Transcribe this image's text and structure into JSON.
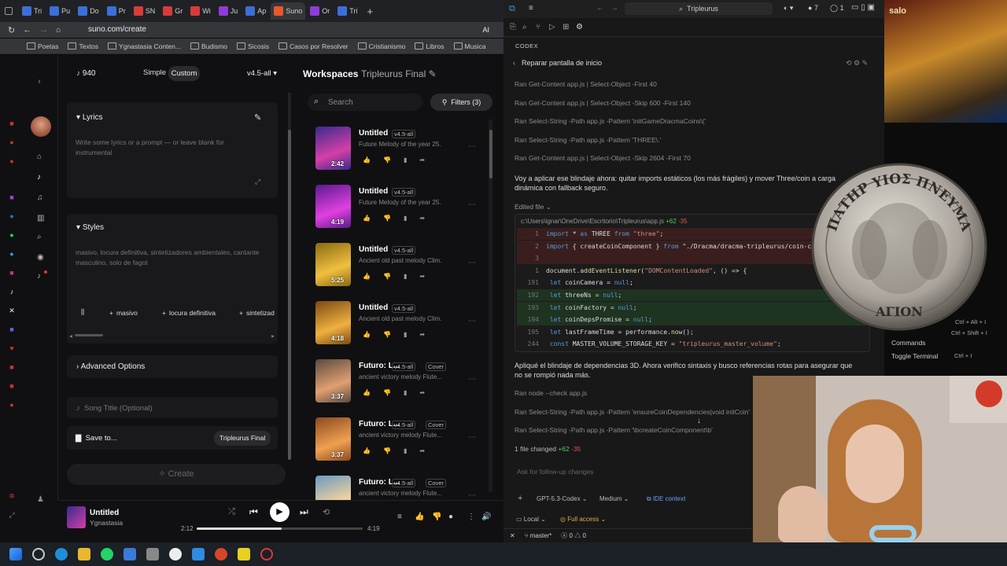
{
  "browser": {
    "tabs": [
      {
        "label": "Tri",
        "color": "#3b6fd8"
      },
      {
        "label": "Pu",
        "color": "#3b6fd8"
      },
      {
        "label": "Do",
        "color": "#3b6fd8"
      },
      {
        "label": "Pr",
        "color": "#3b6fd8"
      },
      {
        "label": "SN",
        "color": "#d83b3b"
      },
      {
        "label": "Gr",
        "color": "#d83b3b"
      },
      {
        "label": "Wi",
        "color": "#d83b3b"
      },
      {
        "label": "Ju",
        "color": "#8e3bd8"
      },
      {
        "label": "Ap",
        "color": "#3b6fd8"
      },
      {
        "label": "Suno",
        "color": "#e8582b",
        "active": true
      },
      {
        "label": "Or",
        "color": "#8e3bd8"
      },
      {
        "label": "Tri",
        "color": "#3b6fd8"
      }
    ],
    "new_tab": "+",
    "url": "suno.com/create",
    "ai_label": "AI",
    "bookmarks": [
      "Poetas",
      "Textos",
      "Ygnastasia Conten...",
      "Budismo",
      "Sicosis",
      "Casos por Resolver",
      "Cristianismo",
      "Libros",
      "Musica"
    ]
  },
  "suno": {
    "credits": "940",
    "mode_simple": "Simple",
    "mode_custom": "Custom",
    "version": "v4.5-all",
    "lyrics": {
      "title": "Lyrics",
      "placeholder": "Write some lyrics or a prompt — or leave blank for instrumental"
    },
    "styles": {
      "title": "Styles",
      "placeholder": "masivo, locura definitiva, sintetizadores ambientales, cantante masculino, solo de fagot"
    },
    "style_chips": [
      "masivo",
      "locura definitiva",
      "sintetizad"
    ],
    "advanced": "Advanced Options",
    "song_title_placeholder": "Song Title (Optional)",
    "save_to": "Save to...",
    "save_target": "Tripleurus Final",
    "create": "Create",
    "workspaces": "Workspaces",
    "workspace_title": "Tripleurus Final",
    "search_placeholder": "Search",
    "filters": "Filters (3)",
    "songs": [
      {
        "title": "Untitled",
        "version": "v4.5-all",
        "desc": "Future Melody of the year 25...",
        "duration": "2:42",
        "c1": "#3a2a8e",
        "c2": "#d53fa8",
        "cover": ""
      },
      {
        "title": "Untitled",
        "version": "v4.5-all",
        "desc": "Future Melody of the year 25...",
        "duration": "4:19",
        "c1": "#5a1a8e",
        "c2": "#e040e0",
        "cover": ""
      },
      {
        "title": "Untitled",
        "version": "v4.5-all",
        "desc": "Ancient old past melody Clim...",
        "duration": "5:25",
        "c1": "#8a6a10",
        "c2": "#f0c040",
        "cover": ""
      },
      {
        "title": "Untitled",
        "version": "v4.5-all",
        "desc": "Ancient old past melody Clim...",
        "duration": "4:18",
        "c1": "#7a4a10",
        "c2": "#f0b040",
        "cover": ""
      },
      {
        "title": "Futuro: L...",
        "version": "v4.5-all",
        "desc": "ancient victory melody Flute...",
        "duration": "3:37",
        "c1": "#5a4a40",
        "c2": "#e0a070",
        "cover": "Cover"
      },
      {
        "title": "Futuro: L...",
        "version": "v4.5-all",
        "desc": "ancient victory melody Flute...",
        "duration": "3:37",
        "c1": "#8a4a20",
        "c2": "#f0a050",
        "cover": "Cover"
      },
      {
        "title": "Futuro: L...",
        "version": "v4.5-all",
        "desc": "ancient victory melody Flute...",
        "duration": "",
        "c1": "#6a9ac0",
        "c2": "#f0d0a0",
        "cover": "Cover"
      }
    ],
    "player": {
      "title": "Untitled",
      "artist": "Ygnastasia",
      "elapsed": "2:12",
      "total": "4:19",
      "progress": 0.51
    }
  },
  "vscode": {
    "search": "Tripleurus",
    "badge_count": "7",
    "badge_count2": "1",
    "codex_header": "CODEX",
    "repair": "Reparar pantalla de inicio",
    "ran_lines_top": [
      {
        "verb": "Ran",
        "cmd": "Get-Content app.js | Select-Object -First 40"
      },
      {
        "verb": "Ran",
        "cmd": "Get-Content app.js | Select-Object -Skip 600 -First 140"
      },
      {
        "verb": "Ran",
        "cmd": "Select-String -Path app.js -Pattern 'initGameDracmaCoins\\('"
      },
      {
        "verb": "Ran",
        "cmd": "Select-String -Path app.js -Pattern 'THREE\\.'"
      },
      {
        "verb": "Ran",
        "cmd": "Get-Content app.js | Select-Object -Skip 2604 -First 70"
      }
    ],
    "message1": "Voy a aplicar ese blindaje ahora: quitar imports estáticos (los más frágiles) y mover Three/coin a carga dinámica con fallback seguro.",
    "edited_file": "Edited file",
    "file_path": "c:\\Users\\ignar\\OneDrive\\Escritorio\\Tripleurus\\app.js",
    "file_plus": "+62",
    "file_minus": "-35",
    "code": [
      {
        "n": "1",
        "type": "del",
        "text": "import * as THREE from \"three\";"
      },
      {
        "n": "2",
        "type": "del",
        "text": "import { createCoinComponent } from \"./Dracma/dracma-tripleurus/coin-co"
      },
      {
        "n": "3",
        "type": "del",
        "text": ""
      },
      {
        "n": "1",
        "type": "ctx",
        "text": "document.addEventListener(\"DOMContentLoaded\", () => {"
      },
      {
        "n": "191",
        "type": "ctx",
        "text": "  let coinCamera = null;"
      },
      {
        "n": "192",
        "type": "add",
        "text": "  let threeNs = null;"
      },
      {
        "n": "193",
        "type": "add",
        "text": "  let coinFactory = null;"
      },
      {
        "n": "194",
        "type": "add",
        "text": "  let coinDepsPromise = null;"
      },
      {
        "n": "195",
        "type": "ctx",
        "text": "  let lastFrameTime = performance.now();"
      },
      {
        "n": "244",
        "type": "ctx",
        "text": "  const MASTER_VOLUME_STORAGE_KEY = \"tripleurus_master_volume\";"
      }
    ],
    "message2": "Apliqué el blindaje de dependencias 3D. Ahora verifico sintaxis y busco referencias rotas para asegurar que no se rompió nada más.",
    "ran_lines_bottom": [
      {
        "verb": "Ran",
        "cmd": "node --check app.js"
      },
      {
        "verb": "Ran",
        "cmd": "Select-String -Path app.js -Pattern 'ensureCoinDependencies|void initCoin'"
      },
      {
        "verb": "Ran",
        "cmd": "Select-String -Path app.js -Pattern '\\bcreateCoinComponent\\b'"
      }
    ],
    "files_changed": "1 file changed",
    "ask_placeholder": "Ask for follow-up changes",
    "model": "GPT-5.3-Codex",
    "effort": "Medium",
    "ide_context": "IDE context",
    "local": "Local",
    "access": "Full access",
    "branch": "master*",
    "errors": "0",
    "warnings": "0"
  },
  "desktop": {
    "coin_text_top": "ΠΑΤΗΡ ΥΙΟΣ ΠΝΕΥΜΑ",
    "coin_text_bottom": "ΑΓΙΟΝ",
    "commands": "Commands",
    "toggle_terminal": "Toggle Terminal",
    "shortcut1": "Ctrl + Alt + I",
    "shortcut2": "Ctrl + Shift + I",
    "shortcut3": "Ctrl + I",
    "book_label": "salo"
  }
}
